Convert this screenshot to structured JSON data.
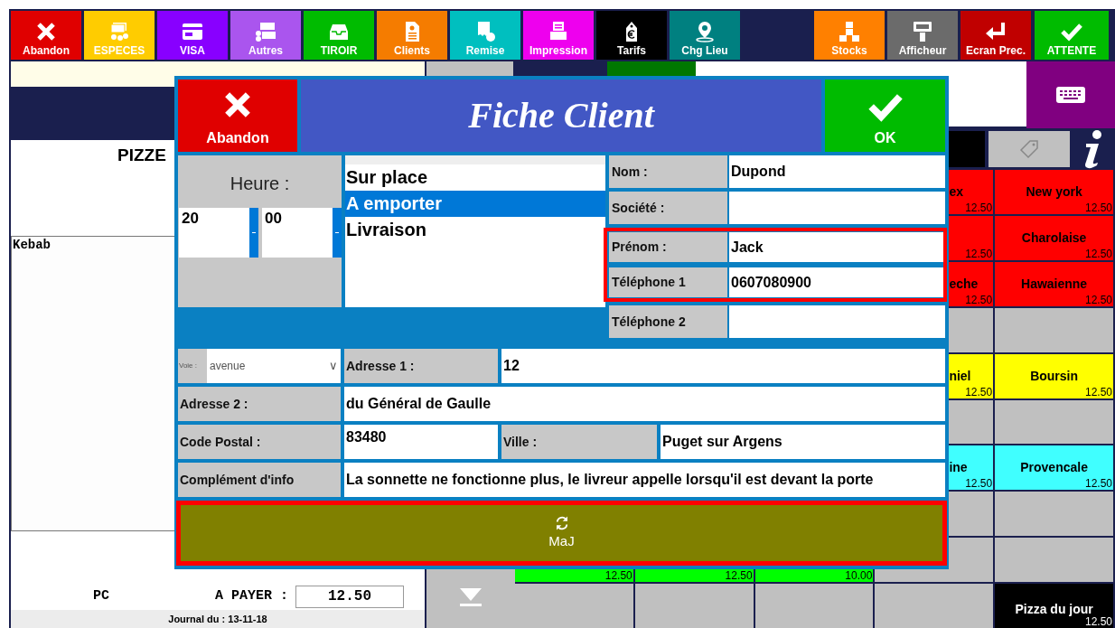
{
  "toolbar": {
    "left": [
      {
        "label": "Abandon",
        "color": "#e00000",
        "kind": "cancel"
      },
      {
        "label": "ESPECES",
        "color": "#ffcc00",
        "kind": "cash"
      },
      {
        "label": "VISA",
        "color": "#8800ff",
        "kind": "card"
      },
      {
        "label": "Autres",
        "color": "#aa55ee",
        "kind": "other"
      },
      {
        "label": "TIROIR",
        "color": "#00bb00",
        "kind": "drawer"
      },
      {
        "label": "Clients",
        "color": "#f57c00",
        "kind": "clients"
      },
      {
        "label": "Remise",
        "color": "#00bfbf",
        "kind": "discount"
      },
      {
        "label": "Impression",
        "color": "#ee00ee",
        "kind": "print"
      },
      {
        "label": "Tarifs",
        "color": "#000000",
        "kind": "prices"
      },
      {
        "label": "Chg Lieu",
        "color": "#008080",
        "kind": "place"
      }
    ],
    "right": [
      {
        "label": "Stocks",
        "color": "#ff8000",
        "kind": "stocks"
      },
      {
        "label": "Afficheur",
        "color": "#6b6b6b",
        "kind": "display"
      },
      {
        "label": "Ecran Prec.",
        "color": "#c00000",
        "kind": "back"
      },
      {
        "label": "ATTENTE",
        "color": "#00bb00",
        "kind": "hold"
      }
    ]
  },
  "order": {
    "title": "PIZZE",
    "items": [
      "Kebab"
    ],
    "seller": "PC",
    "total_label": "A PAYER :",
    "total": "12.50",
    "journal": "Journal du : 13-11-18"
  },
  "product_grid": {
    "rows": [
      [
        {
          "color": "#ff0000",
          "name": "ex",
          "price": "12.50"
        },
        {
          "color": "#ff0000",
          "name": "New york",
          "price": "12.50"
        }
      ],
      [
        {
          "color": "#ff0000",
          "price": "12.50"
        },
        {
          "color": "#ff0000",
          "name": "Charolaise",
          "price": "12.50"
        }
      ],
      [
        {
          "color": "#ff0000",
          "name": "eche",
          "price": "12.50"
        },
        {
          "color": "#ff0000",
          "name": "Hawaienne",
          "price": "12.50"
        }
      ],
      [
        {
          "color": "#c0c0c0"
        },
        {
          "color": "#c0c0c0"
        }
      ],
      [
        {
          "color": "#ffff00",
          "name": "niel",
          "price": "12.50"
        },
        {
          "color": "#ffff00",
          "name": "Boursin",
          "price": "12.50"
        }
      ],
      [
        {
          "color": "#c0c0c0"
        },
        {
          "color": "#c0c0c0"
        }
      ],
      [
        {
          "color": "#40ffff",
          "name": "ine",
          "price": "12.50"
        },
        {
          "color": "#40ffff",
          "name": "Provencale",
          "price": "12.50"
        }
      ],
      [
        {
          "color": "#c0c0c0"
        },
        {
          "color": "#c0c0c0"
        }
      ],
      [
        {
          "color": "#00ff00",
          "price": "12.50"
        },
        {
          "color": "#00ff00",
          "price": "12.50"
        },
        {
          "color": "#00ff00",
          "price": "10.00"
        },
        {
          "color": "#c0c0c0"
        },
        {
          "color": "#c0c0c0"
        }
      ],
      [
        {
          "color": "#c0c0c0"
        },
        {
          "color": "#c0c0c0"
        },
        {
          "color": "#c0c0c0"
        },
        {
          "color": "#c0c0c0"
        },
        {
          "color": "#000000",
          "name": "Pizza du jour",
          "price": "12.50"
        }
      ]
    ]
  },
  "dialog": {
    "cancel": "Abandon",
    "title": "Fiche Client",
    "ok": "OK",
    "time_label": "Heure :",
    "hour": "20",
    "minute": "00",
    "order_types": [
      {
        "label": "Sur place",
        "selected": false
      },
      {
        "label": "A emporter",
        "selected": true
      },
      {
        "label": "Livraison",
        "selected": false
      }
    ],
    "fields": [
      {
        "label": "Nom :",
        "value": "Dupond",
        "highlighted": false
      },
      {
        "label": "Société :",
        "highlighted": false
      },
      {
        "label": "Prénom :",
        "value": "Jack",
        "highlighted": true
      },
      {
        "label": "Téléphone 1",
        "value": "0607080900",
        "highlighted": true
      },
      {
        "label": "Téléphone 2",
        "highlighted": false
      }
    ],
    "street_type_label": "Voie :",
    "street_type": "avenue",
    "street_type_caret": "∨",
    "address1_label": "Adresse 1 :",
    "address1": "12",
    "address2_label": "Adresse 2 :",
    "address2": "du Général de Gaulle",
    "postcode_label": "Code Postal :",
    "postcode": "83480",
    "city_label": "Ville :",
    "city": "Puget sur Argens",
    "info_label": "Complément d'info",
    "info": "La sonnette ne fonctionne plus, le livreur appelle lorsqu'il est devant la porte",
    "update": "MaJ"
  }
}
